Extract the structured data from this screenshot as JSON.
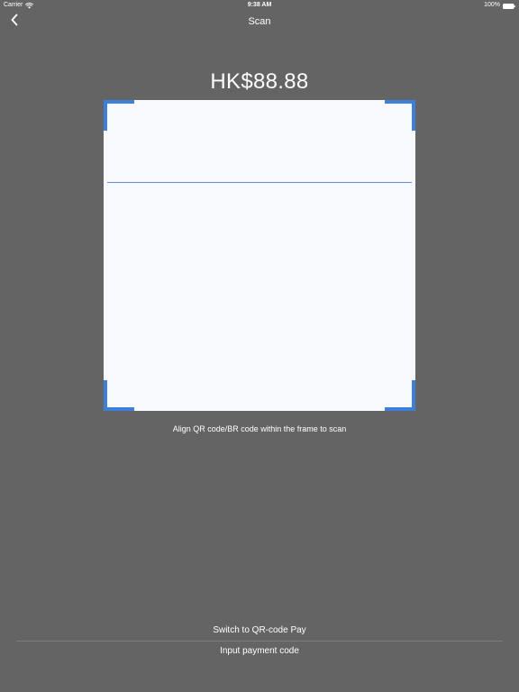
{
  "status_bar": {
    "carrier": "Carrier",
    "time": "9:38 AM",
    "battery": "100%",
    "wifi_icon": "wifi-icon",
    "battery_icon": "battery-icon"
  },
  "nav": {
    "back_icon": "chevron-left-icon",
    "title": "Scan"
  },
  "amount": "HK$88.88",
  "scanner": {
    "hint": "Align QR code/BR code within the frame to scan",
    "accent_color": "#3e7fd9"
  },
  "actions": {
    "switch_label": "Switch to QR-code Pay",
    "input_label": "Input payment code"
  },
  "colors": {
    "background": "#646464",
    "frame_background": "#f7f9fc"
  }
}
